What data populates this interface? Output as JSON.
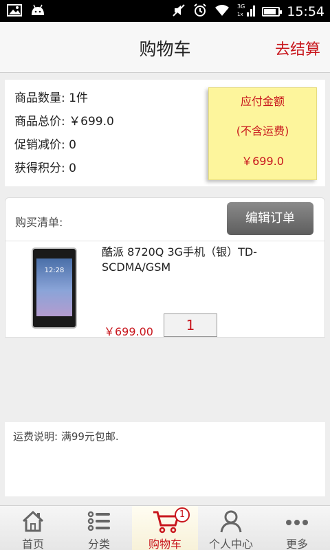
{
  "status_bar": {
    "time": "15:54",
    "network": "3G",
    "battery_level": 0.85,
    "icons": [
      "image-icon",
      "android-icon",
      "mute-icon",
      "alarm-icon",
      "wifi-icon",
      "signal-icon",
      "battery-icon"
    ]
  },
  "header": {
    "title": "购物车",
    "checkout_label": "去结算"
  },
  "summary": {
    "count": "商品数量: 1件",
    "total": "商品总价: ￥699.0",
    "discount": "促销减价: 0",
    "points": "获得积分: 0"
  },
  "payable": {
    "label": "应付金额",
    "note": "(不含运费)",
    "amount": "￥699.0"
  },
  "order": {
    "list_label": "购买清单:",
    "edit_label": "编辑订单",
    "items": [
      {
        "name": "酷派 8720Q 3G手机（银）TD-SCDMA/GSM",
        "price": "￥699.00",
        "quantity": "1",
        "image_clock": "12:28"
      }
    ]
  },
  "shipping": {
    "text": "运费说明: 满99元包邮."
  },
  "tabs": [
    {
      "label": "首页",
      "icon": "home-icon",
      "active": false
    },
    {
      "label": "分类",
      "icon": "list-icon",
      "active": false
    },
    {
      "label": "购物车",
      "icon": "cart-icon",
      "active": true,
      "badge": "1"
    },
    {
      "label": "个人中心",
      "icon": "user-icon",
      "active": false
    },
    {
      "label": "更多",
      "icon": "more-icon",
      "active": false
    }
  ],
  "colors": {
    "accent": "#c8161d",
    "sticky": "#fdf59c"
  }
}
